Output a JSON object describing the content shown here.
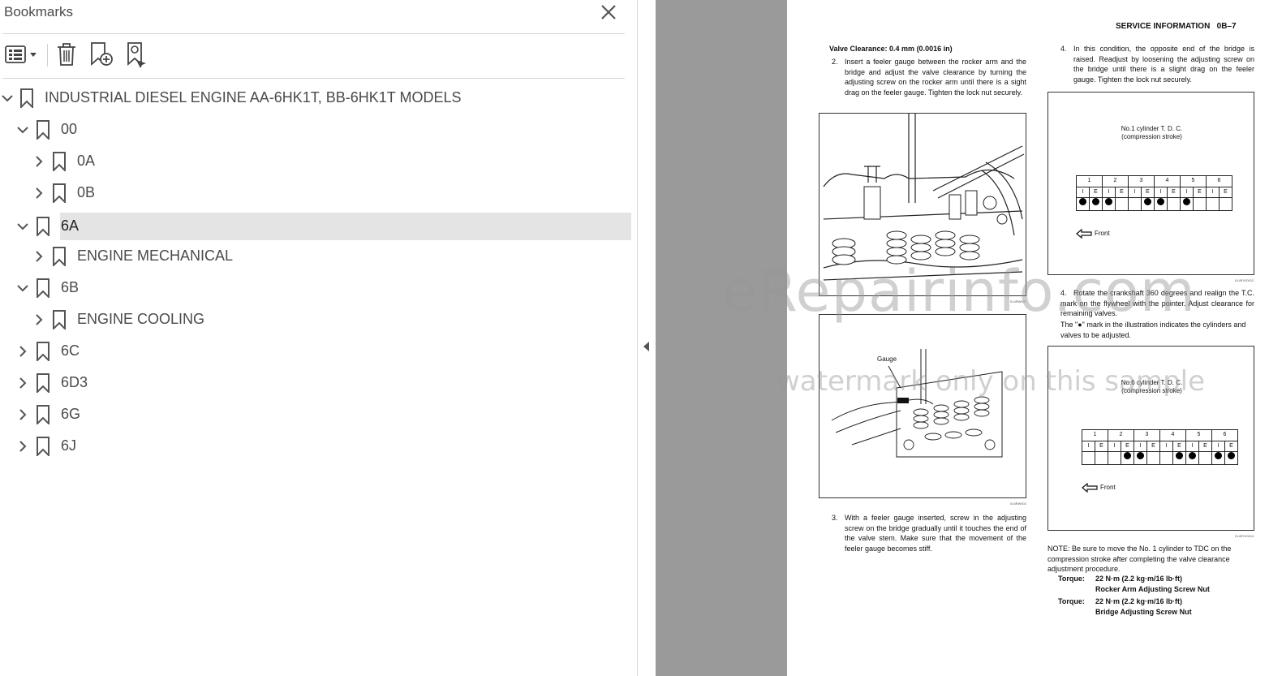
{
  "panel": {
    "title": "Bookmarks",
    "bookmarks": [
      {
        "label": "INDUSTRIAL DIESEL ENGINE AA-6HK1T, BB-6HK1T MODELS",
        "expanded": true,
        "level": 0
      },
      {
        "label": "00",
        "expanded": true,
        "level": 1
      },
      {
        "label": "0A",
        "expanded": false,
        "level": 2
      },
      {
        "label": "0B",
        "expanded": false,
        "level": 2
      },
      {
        "label": "6A",
        "expanded": true,
        "level": 1,
        "selected": true
      },
      {
        "label": "ENGINE MECHANICAL",
        "expanded": false,
        "level": 2
      },
      {
        "label": "6B",
        "expanded": true,
        "level": 1
      },
      {
        "label": "ENGINE COOLING",
        "expanded": false,
        "level": 2
      },
      {
        "label": "6C",
        "expanded": false,
        "level": 1
      },
      {
        "label": "6D3",
        "expanded": false,
        "level": 1
      },
      {
        "label": "6G",
        "expanded": false,
        "level": 1
      },
      {
        "label": "6J",
        "expanded": false,
        "level": 1
      }
    ]
  },
  "document": {
    "header": "SERVICE INFORMATION   0B–7",
    "left": {
      "heading": "Valve Clearance: 0.4 mm (0.0016 in)",
      "step2_num": "2.",
      "step2": "Insert a feeler gauge between the rocker arm and the bridge and adjust the valve clearance by turning the adjusting screw on the rocker arm until there is a sight drag on the feeler gauge. Tighten the lock nut securely.",
      "fig1_code": "014RW007",
      "gauge_label": "Gauge",
      "fig2_code": "014RW002",
      "step3_num": "3.",
      "step3": "With a feeler gauge inserted, screw in the adjusting screw on the bridge gradually until it touches the end of the valve stem. Make sure that the movement of the feeler gauge becomes stiff."
    },
    "right": {
      "step4a_num": "4.",
      "step4a": "In this condition, the opposite end of the bridge is raised. Readjust by loosening the adjusting screw on the bridge until there is a slight drag on the feeler gauge. Tighten the lock nut securely.",
      "tdc1_title": "No.1 cylinder T. D. C.",
      "tdc1_sub": "(compression stroke)",
      "cylinders": [
        "1",
        "2",
        "3",
        "4",
        "5",
        "6"
      ],
      "valves": [
        "I",
        "E",
        "I",
        "E",
        "I",
        "E",
        "I",
        "E",
        "I",
        "E",
        "I",
        "E"
      ],
      "tdc1_marks": [
        1,
        1,
        1,
        0,
        0,
        1,
        1,
        0,
        1,
        0,
        0,
        0
      ],
      "front_label": "Front",
      "fig3_code": "014RY00012",
      "step4b_num": "4.",
      "step4b": "Rotate the crankshaft 360 degrees and realign the T.C. mark on the flywheel with the pointer. Adjust clearance for remaining valves.",
      "step4b_note": "The \"●\" mark in the illustration indicates the cylinders and valves to be adjusted.",
      "tdc6_title": "No.6 cylinder T. D. C.",
      "tdc6_sub": "(compression stroke)",
      "tdc6_marks": [
        0,
        0,
        0,
        1,
        1,
        0,
        0,
        1,
        1,
        0,
        1,
        1
      ],
      "fig4_code": "014RY00013",
      "note": "NOTE: Be sure to move the No. 1 cylinder to TDC on the compression stroke after completing the valve clearance adjustment procedure.",
      "torque_label": "Torque:",
      "torque1_value": "22 N·m (2.2 kg·m/16 lb·ft)",
      "torque1_item": "Rocker Arm Adjusting Screw Nut",
      "torque2_value": "22 N·m (2.2 kg·m/16 lb·ft)",
      "torque2_item": "Bridge Adjusting Screw Nut"
    },
    "watermark1": "eRepairinfo.com",
    "watermark2": "watermark only on this sample"
  }
}
